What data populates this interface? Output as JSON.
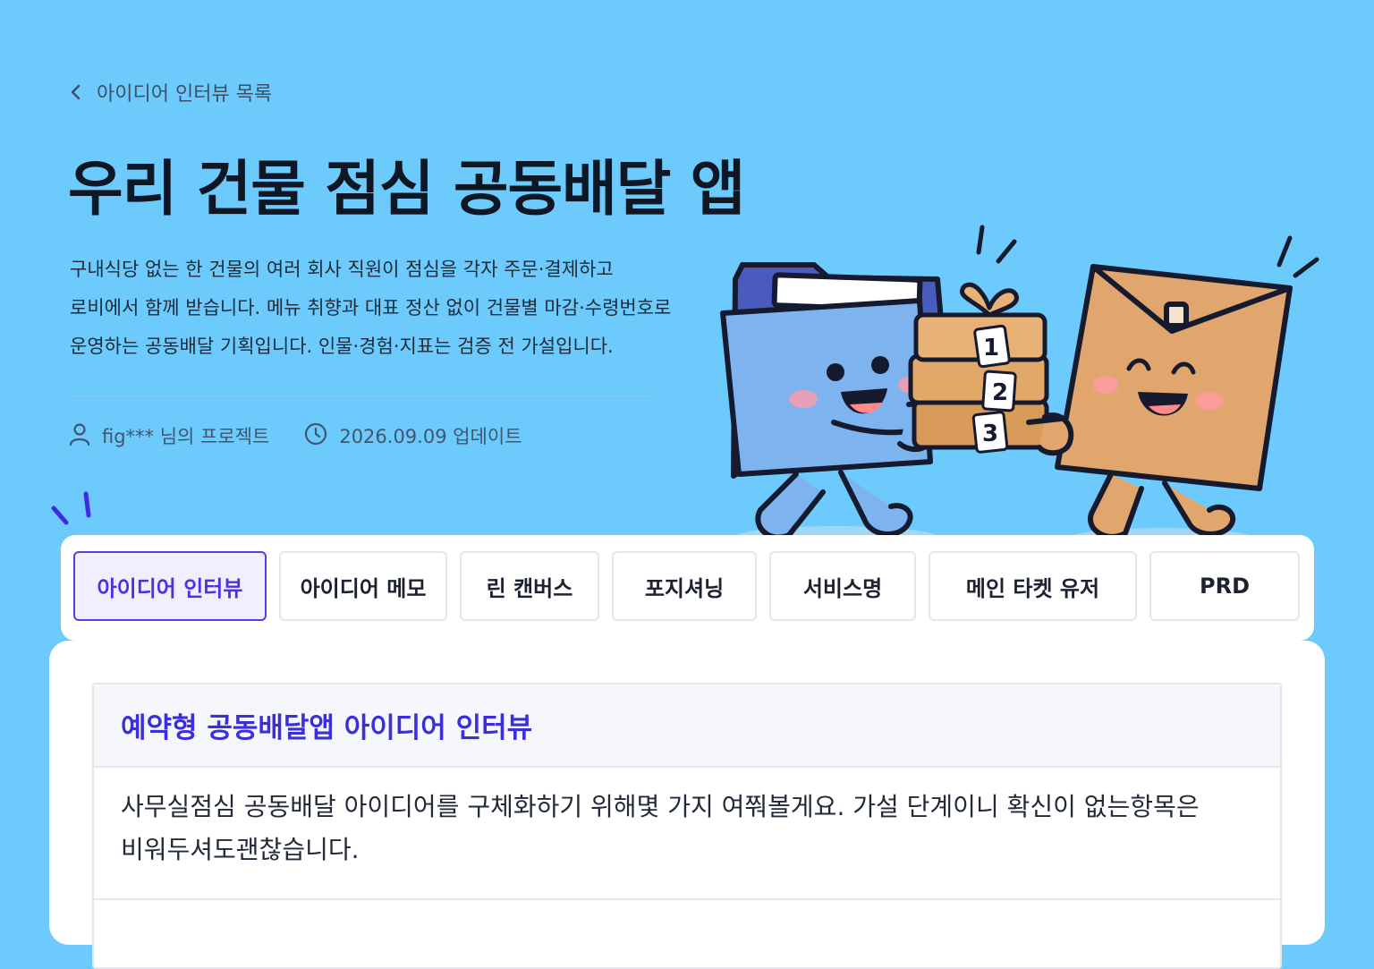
{
  "header": {
    "back_label": "아이디어 인터뷰 목록",
    "title": "우리 건물 점심 공동배달 앱",
    "description_lines": [
      "구내식당 없는 한 건물의 여러 회사 직원이 점심을 각자 주문·결제하고",
      "로비에서 함께 받습니다. 메뉴 취향과 대표 정산 없이 건물별 마감·수령번호로",
      "운영하는 공동배달 기획입니다. 인물·경험·지표는 검증 전 가설입니다."
    ],
    "owner": "fig*** 님의 프로젝트",
    "updated": "2026.09.09 업데이트"
  },
  "illustration": {
    "box_labels": [
      "1",
      "2",
      "3"
    ]
  },
  "tabs": [
    {
      "label": "아이디어 인터뷰",
      "active": true
    },
    {
      "label": "아이디어 메모",
      "active": false
    },
    {
      "label": "린 캔버스",
      "active": false
    },
    {
      "label": "포지셔닝",
      "active": false
    },
    {
      "label": "서비스명",
      "active": false
    },
    {
      "label": "메인 타켓 유저",
      "active": false
    },
    {
      "label": "PRD",
      "active": false
    }
  ],
  "panel": {
    "title": "예약형 공동배달앱 아이디어 인터뷰",
    "body_lines": [
      "사무실점심 공동배달 아이디어를 구체화하기 위해몇 가지 여쭤볼게요. 가설 단계이니 확신이 없는항목은",
      "비워두셔도괜찮습니다."
    ]
  },
  "colors": {
    "background": "#6ccbfc",
    "accent": "#4a34e0",
    "folder": "#7db4ef",
    "envelope": "#e0a66d"
  }
}
